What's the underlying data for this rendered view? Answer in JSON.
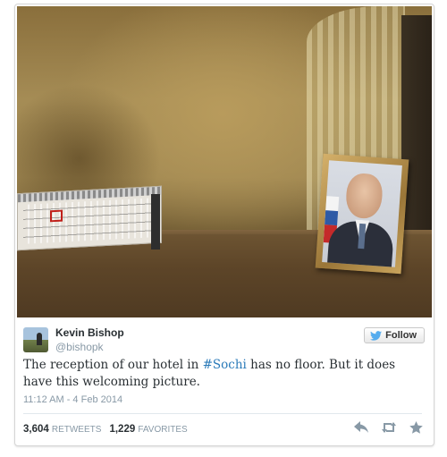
{
  "tweet": {
    "author_name": "Kevin Bishop",
    "author_handle": "@bishopk",
    "follow_label": "Follow",
    "text_before": "The reception of our hotel in ",
    "hashtag": "#Sochi",
    "text_after": " has no floor. But it does have this welcoming picture.",
    "timestamp": "11:12 AM - 4 Feb 2014",
    "retweets_count": "3,604",
    "retweets_label": "RETWEETS",
    "favorites_count": "1,229",
    "favorites_label": "FAVORITES"
  },
  "icons": {
    "follow": "twitter-bird-icon",
    "reply": "reply-icon",
    "retweet": "retweet-icon",
    "favorite": "star-icon"
  },
  "colors": {
    "hashtag": "#2b7bb9",
    "twitter_blue": "#55acee",
    "text": "#292f33",
    "muted": "#8899a6"
  }
}
